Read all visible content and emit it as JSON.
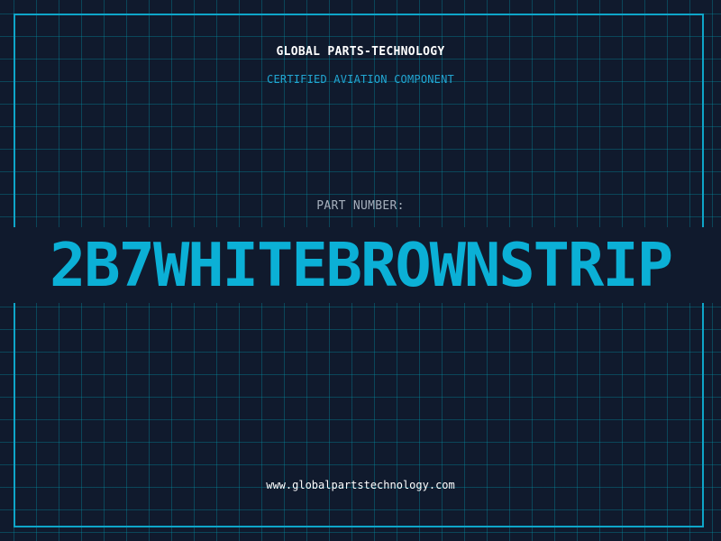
{
  "header": {
    "company_name": "GLOBAL PARTS-TECHNOLOGY",
    "subtitle": "CERTIFIED AVIATION COMPONENT"
  },
  "part": {
    "label": "PART NUMBER:",
    "number": "2B7WHITEBROWNSTRIP"
  },
  "footer": {
    "website": "www.globalpartstechnology.com"
  },
  "colors": {
    "background": "#101a2d",
    "accent": "#0bb0d6",
    "grid": "#0e6f83",
    "label": "#a6b0bd",
    "text": "#ffffff"
  }
}
